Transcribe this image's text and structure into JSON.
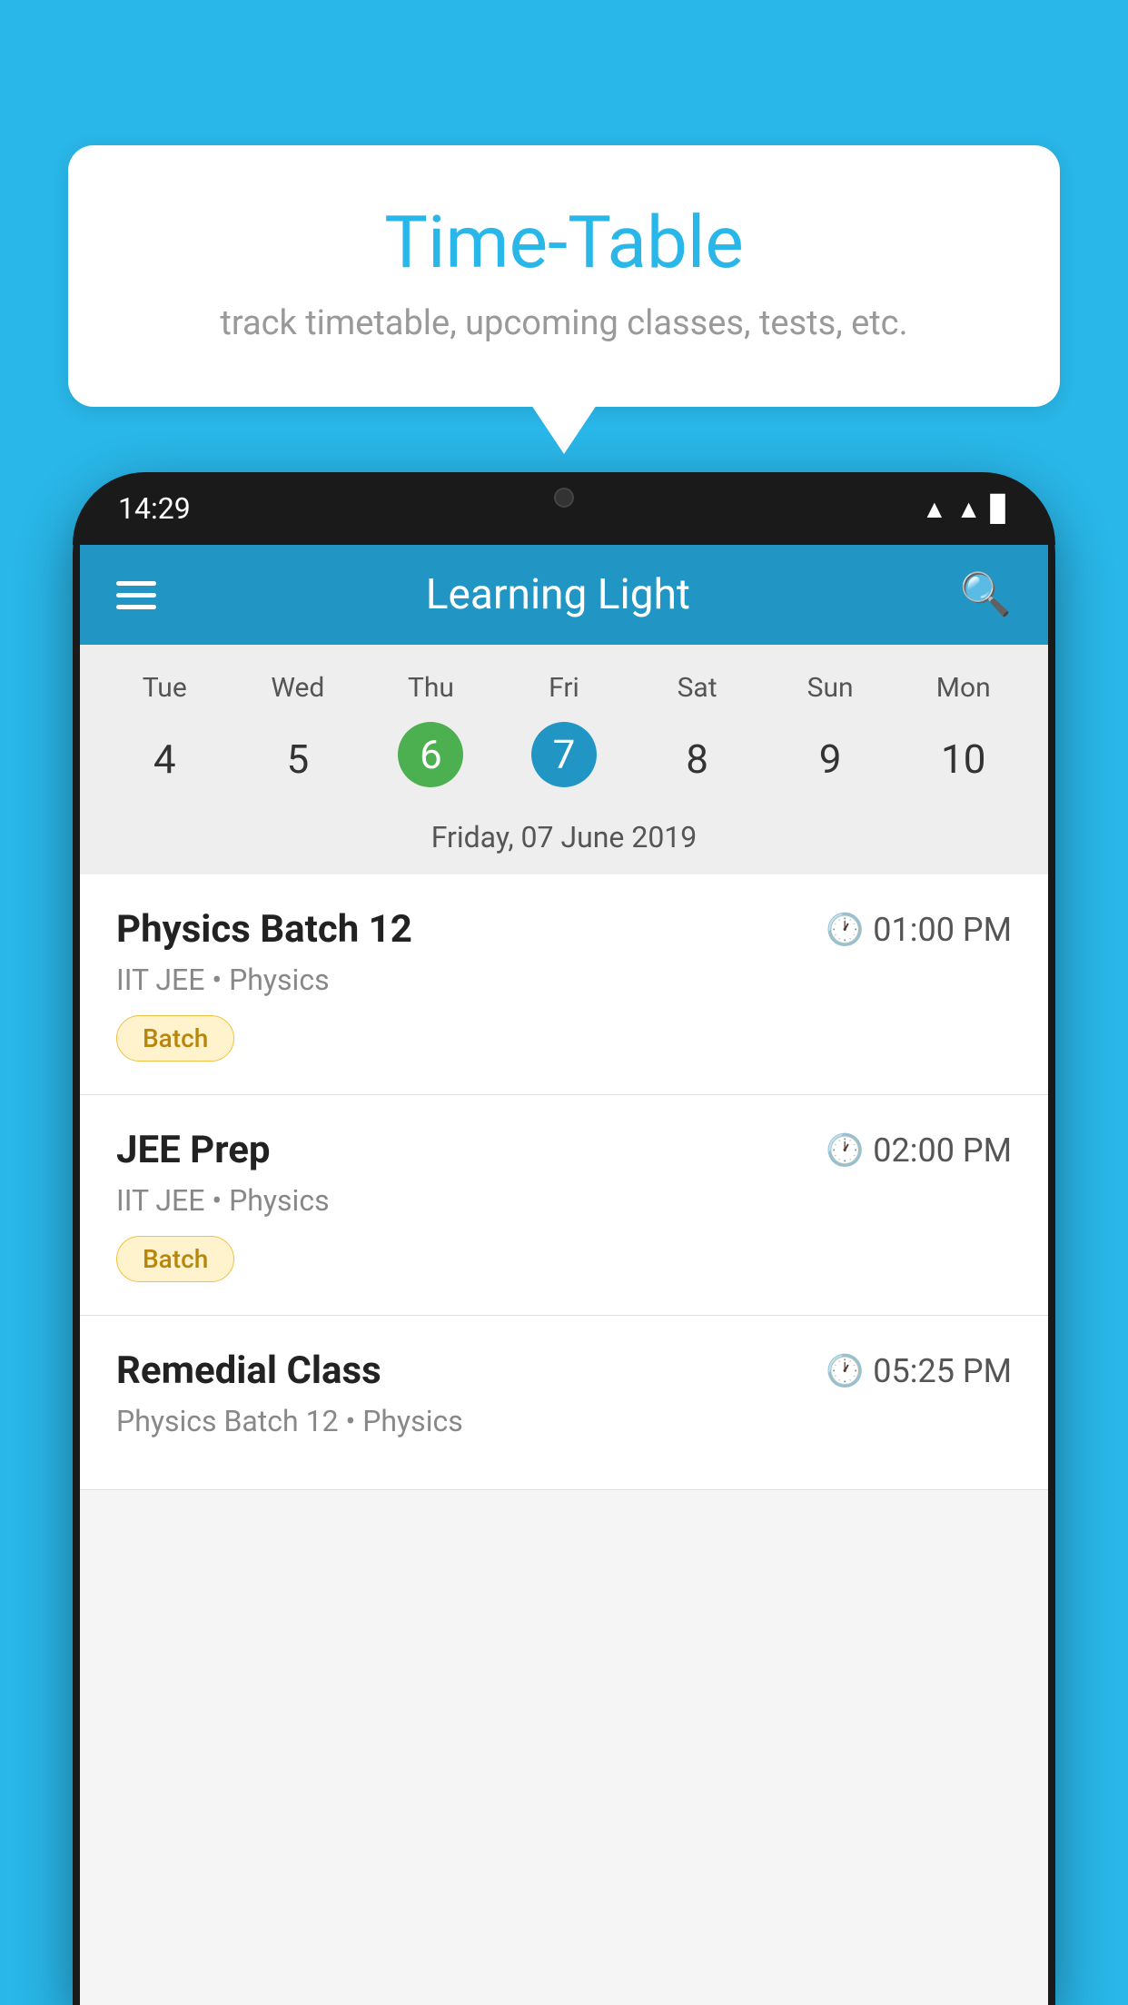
{
  "background_color": "#29B6E8",
  "bubble": {
    "title": "Time-Table",
    "subtitle": "track timetable, upcoming classes, tests, etc."
  },
  "phone": {
    "status_bar": {
      "time": "14:29"
    },
    "app_header": {
      "title": "Learning Light"
    },
    "calendar": {
      "day_names": [
        "Tue",
        "Wed",
        "Thu",
        "Fri",
        "Sat",
        "Sun",
        "Mon"
      ],
      "day_numbers": [
        "4",
        "5",
        "6",
        "7",
        "8",
        "9",
        "10"
      ],
      "today_index": 2,
      "selected_index": 3,
      "selected_date_label": "Friday, 07 June 2019"
    },
    "schedule": [
      {
        "title": "Physics Batch 12",
        "time": "01:00 PM",
        "subtitle": "IIT JEE • Physics",
        "badge": "Batch"
      },
      {
        "title": "JEE Prep",
        "time": "02:00 PM",
        "subtitle": "IIT JEE • Physics",
        "badge": "Batch"
      },
      {
        "title": "Remedial Class",
        "time": "05:25 PM",
        "subtitle": "Physics Batch 12 • Physics",
        "badge": ""
      }
    ]
  }
}
